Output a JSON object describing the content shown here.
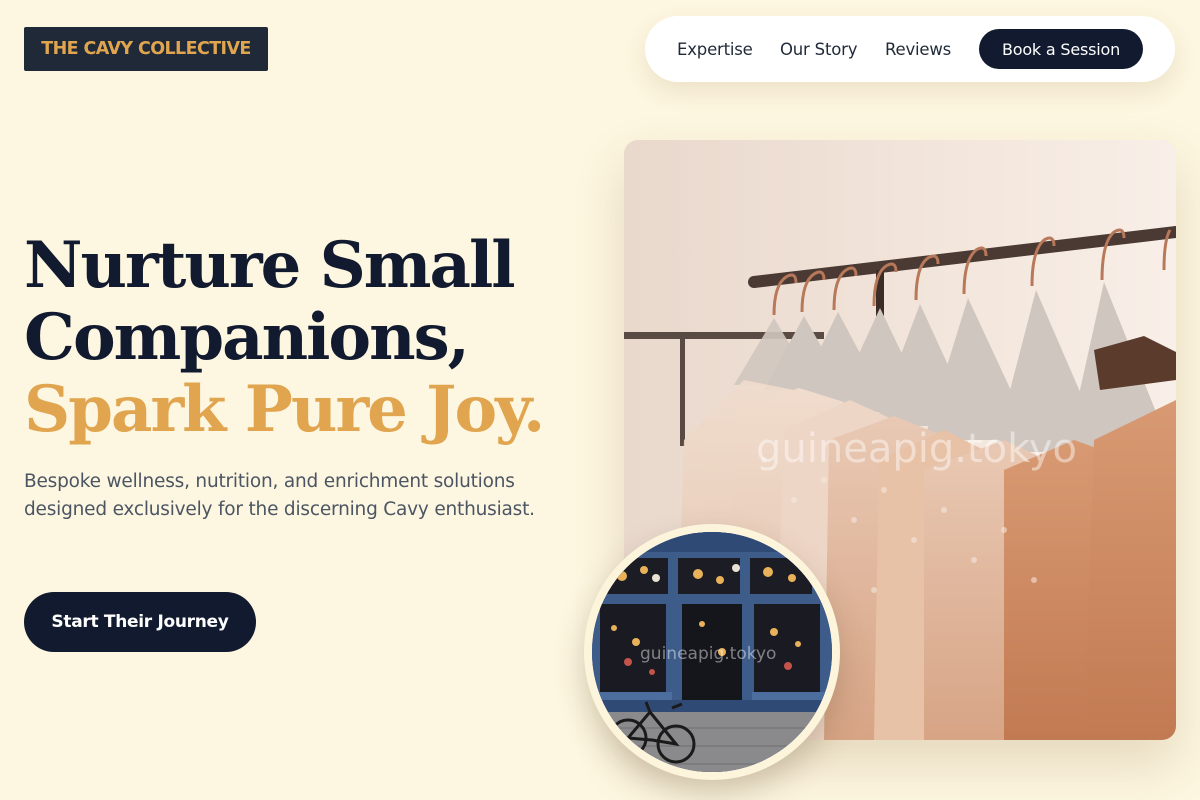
{
  "brand": {
    "logo_text": "THE CAVY COLLECTIVE"
  },
  "nav": {
    "links": [
      "Expertise",
      "Our Story",
      "Reviews"
    ],
    "cta_label": "Book a Session"
  },
  "hero": {
    "headline_line1": "Nurture Small",
    "headline_line2": "Companions,",
    "headline_line3": "Spark Pure Joy.",
    "subtitle": "Bespoke wellness, nutrition, and enrichment solutions designed exclusively for the discerning Cavy enthusiast.",
    "cta_label": "Start Their Journey"
  },
  "images": {
    "main_photo": {
      "subject": "clothing-rack-with-dresses",
      "watermark": "guineapig.tokyo"
    },
    "inset_photo": {
      "subject": "storefront-with-bicycle",
      "watermark": "guineapig.tokyo"
    }
  },
  "colors": {
    "background": "#fdf6e0",
    "navy": "#111a2e",
    "accent": "#e0a54e",
    "body_text": "#4b5563"
  }
}
